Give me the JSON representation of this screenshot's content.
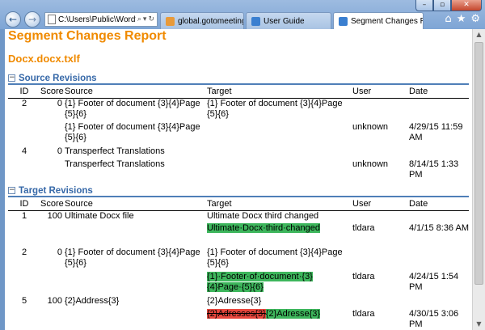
{
  "window": {
    "minimize_glyph": "–",
    "maximize_glyph": "▫",
    "close_glyph": "✕"
  },
  "nav": {
    "back_glyph": "←",
    "forward_glyph": "→"
  },
  "address_bar": {
    "url": "C:\\Users\\Public\\Wordfast\\",
    "search_glyph": "⌕",
    "dropdown_glyph": "▾",
    "refresh_glyph": "↻"
  },
  "tabs": [
    {
      "label": "global.gotomeeting.com",
      "icon_color": "#e89a3a"
    },
    {
      "label": "User Guide",
      "icon_color": "#3a7fd0"
    },
    {
      "label": "Segment Changes Rep...",
      "icon_color": "#3a7fd0",
      "close": "✕"
    }
  ],
  "toolbar": {
    "home_glyph": "⌂",
    "favorites_glyph": "★",
    "settings_glyph": "⚙"
  },
  "report": {
    "title": "Segment Changes Report",
    "document": "Docx.docx.txlf",
    "headers": {
      "id": "ID",
      "score": "Score",
      "source": "Source",
      "target": "Target",
      "user": "User",
      "date": "Date"
    },
    "sections": [
      {
        "title": "Source Revisions",
        "toggle": "⊟",
        "rows": [
          {
            "id": "2",
            "score": "0",
            "source": "{1} Footer of document {3}{4}Page {5}{6}",
            "target": "{1} Footer of document {3}{4}Page {5}{6}",
            "user": "",
            "date": ""
          },
          {
            "id": "",
            "score": "",
            "source": "{1} Footer of document {3}{4}Page {5}{6}",
            "target": "",
            "user": "unknown",
            "date": "4/29/15 11:59 AM"
          },
          {
            "id": "4",
            "score": "0",
            "source": "Transperfect Translations",
            "target": "",
            "user": "",
            "date": ""
          },
          {
            "id": "",
            "score": "",
            "source": "Transperfect Translations",
            "target": "",
            "user": "unknown",
            "date": "8/14/15 1:33 PM"
          }
        ]
      },
      {
        "title": "Target Revisions",
        "toggle": "⊟",
        "rows": [
          {
            "id": "1",
            "score": "100",
            "source": "Ultimate Docx file",
            "target": "Ultimate Docx third changed",
            "user": "",
            "date": ""
          },
          {
            "id": "",
            "score": "",
            "source": "",
            "target_ins": "Ultimate·Docx·third·changed",
            "user": "tldara",
            "date": "4/1/15 8:36 AM"
          },
          {
            "id": "2",
            "score": "0",
            "source": "{1} Footer of document {3}{4}Page {5}{6}",
            "target": "{1} Footer of document {3}{4}Page {5}{6}",
            "user": "",
            "date": ""
          },
          {
            "id": "",
            "score": "",
            "source": "",
            "target_ins": "{1}·Footer·of·document·{3}{4}Page·{5}{6}",
            "user": "tldara",
            "date": "4/24/15 1:54 PM"
          },
          {
            "id": "5",
            "score": "100",
            "source": "{2}Address{3}",
            "target": "{2}Adresse{3}",
            "user": "",
            "date": ""
          },
          {
            "id": "",
            "score": "",
            "source": "",
            "target_del": "{2}Adresses{3}",
            "target_ins": "{2}Adresse{3}",
            "user": "tldara",
            "date": "4/30/15 3:06 PM"
          }
        ]
      }
    ]
  }
}
